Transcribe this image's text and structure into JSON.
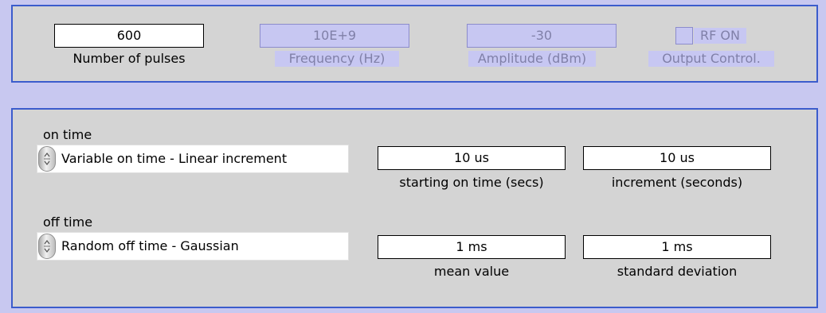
{
  "top": {
    "num_pulses": {
      "value": "600",
      "label": "Number of pulses"
    },
    "frequency": {
      "value": "10E+9",
      "label": "Frequency (Hz)"
    },
    "amplitude": {
      "value": "-30",
      "label": "Amplitude (dBm)"
    },
    "output": {
      "checkbox_label": "RF ON",
      "label": "Output Control."
    }
  },
  "on_time": {
    "caption": "on time",
    "mode": "Variable on time - Linear increment",
    "start": {
      "value": "10 us",
      "label": "starting on time (secs)"
    },
    "increment": {
      "value": "10 us",
      "label": "increment (seconds)"
    }
  },
  "off_time": {
    "caption": "off time",
    "mode": "Random off time - Gaussian",
    "mean": {
      "value": "1 ms",
      "label": "mean value"
    },
    "stddev": {
      "value": "1 ms",
      "label": "standard deviation"
    }
  }
}
